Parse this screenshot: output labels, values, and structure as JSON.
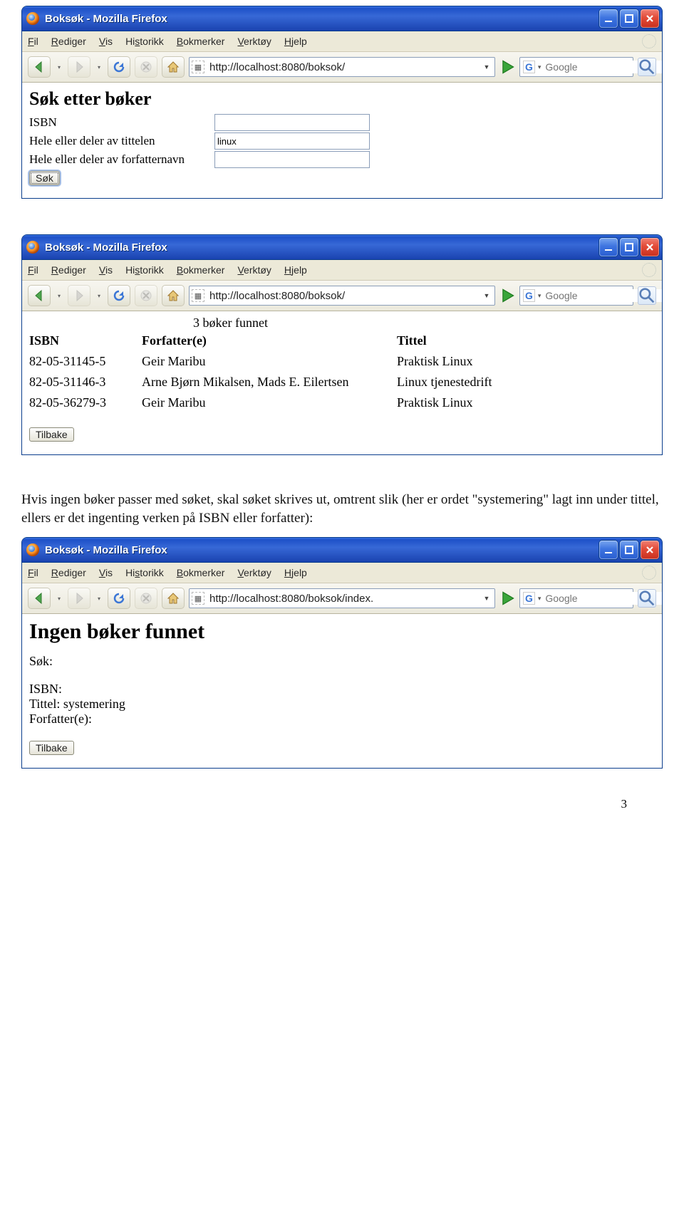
{
  "browser_title": "Boksøk - Mozilla Firefox",
  "menu": [
    "Fil",
    "Rediger",
    "Vis",
    "Historikk",
    "Bokmerker",
    "Verktøy",
    "Hjelp"
  ],
  "menu_ul": [
    0,
    0,
    0,
    2,
    0,
    0,
    0
  ],
  "search_placeholder": "Google",
  "win1": {
    "url": "http://localhost:8080/boksok/",
    "heading": "Søk etter bøker",
    "labels": {
      "isbn": "ISBN",
      "title": "Hele eller deler av tittelen",
      "author": "Hele eller deler av forfatternavn"
    },
    "values": {
      "isbn": "",
      "title": "linux",
      "author": ""
    },
    "submit": "Søk"
  },
  "win2": {
    "url": "http://localhost:8080/boksok/",
    "count_text": "3 bøker funnet",
    "headers": {
      "isbn": "ISBN",
      "author": "Forfatter(e)",
      "title": "Tittel"
    },
    "rows": [
      {
        "isbn": "82-05-31145-5",
        "author": "Geir Maribu",
        "title": "Praktisk Linux"
      },
      {
        "isbn": "82-05-31146-3",
        "author": "Arne Bjørn Mikalsen, Mads E. Eilertsen",
        "title": "Linux tjenestedrift"
      },
      {
        "isbn": "82-05-36279-3",
        "author": "Geir Maribu",
        "title": "Praktisk Linux"
      }
    ],
    "back": "Tilbake"
  },
  "paragraph": "Hvis ingen bøker passer med søket, skal søket skrives ut, omtrent slik (her er ordet \"systemering\" lagt inn under tittel, ellers er det ingenting verken på ISBN eller forfatter):",
  "win3": {
    "url": "http://localhost:8080/boksok/index.",
    "heading": "Ingen bøker funnet",
    "sok_label": "Søk:",
    "lines": {
      "isbn": {
        "label": "ISBN:",
        "value": ""
      },
      "title": {
        "label": "Tittel:",
        "value": "systemering"
      },
      "author": {
        "label": "Forfatter(e):",
        "value": ""
      }
    },
    "back": "Tilbake"
  },
  "page_number": "3"
}
